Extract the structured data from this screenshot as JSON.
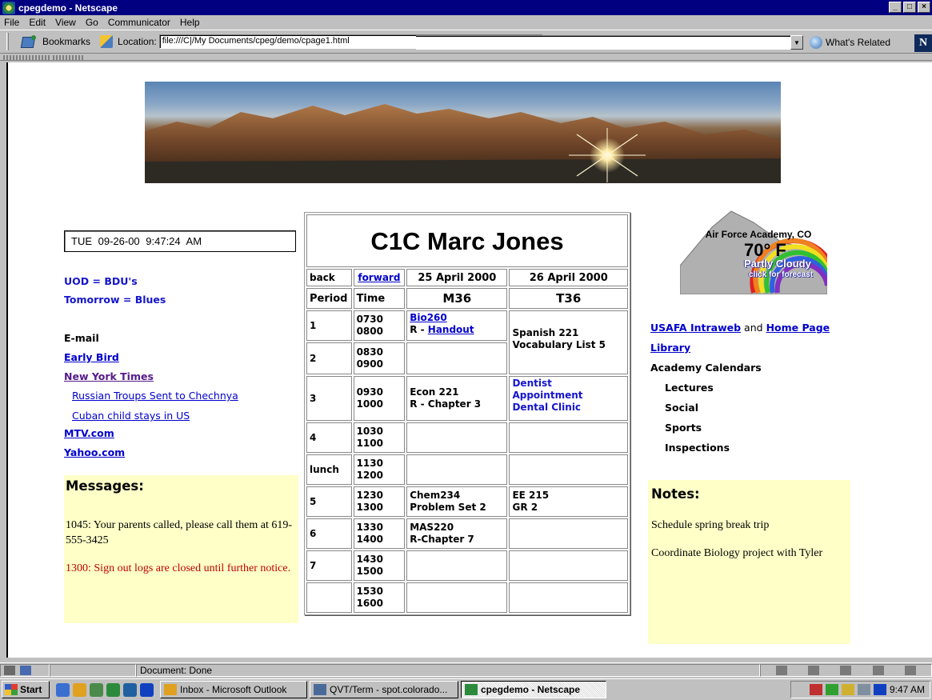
{
  "window": {
    "title": "cpegdemo - Netscape"
  },
  "menu": [
    "File",
    "Edit",
    "View",
    "Go",
    "Communicator",
    "Help"
  ],
  "toolbar": {
    "bookmarks_label": "Bookmarks",
    "location_label": "Location:",
    "url": "file:///C|/My Documents/cpeg/demo/cpage1.html",
    "whats_related_label": "What's Related"
  },
  "left": {
    "clock": "TUE   09-26-00   9:47:24 AM",
    "uod": "UOD = BDU's",
    "tomorrow": "Tomorrow = Blues",
    "email_label": "E-mail",
    "links": {
      "early_bird": "Early Bird",
      "nyt": "New York Times",
      "nyt_story1": "Russian Troups Sent to Chechnya",
      "nyt_story2": "Cuban child stays in US",
      "mtv": "MTV.com",
      "yahoo": "Yahoo.com "
    },
    "messages": {
      "title": "Messages:",
      "items": [
        "1045: Your parents called, please call them at 619-555-3425",
        "1300: Sign out logs are closed until further notice."
      ]
    }
  },
  "schedule": {
    "name": "C1C Marc Jones",
    "back": "back",
    "forward": "forward",
    "date1": "25 April 2000",
    "date2": "26 April 2000",
    "period_header": "Period",
    "time_header": "Time",
    "day1": "M36",
    "day2": "T36",
    "rows": [
      {
        "period": "1",
        "time1": "0730",
        "time2": "0800",
        "d1a": "Bio260",
        "d1b": "R - ",
        "d1link": "Handout",
        "d2": "Spanish 221 Vocabulary List 5"
      },
      {
        "period": "2",
        "time1": "0830",
        "time2": "0900"
      },
      {
        "period": "3",
        "time1": "0930",
        "time2": "1000",
        "d1a": "Econ 221",
        "d1b": "R - Chapter 3",
        "d2a": "Dentist",
        "d2b": "Appointment",
        "d2c": "Dental Clinic"
      },
      {
        "period": "4",
        "time1": "1030",
        "time2": "1100"
      },
      {
        "period": "lunch",
        "time1": "1130",
        "time2": "1200"
      },
      {
        "period": "5",
        "time1": "1230",
        "time2": "1300",
        "d1a": "Chem234",
        "d1b": "Problem Set 2",
        "d2a": "EE 215",
        "d2b": "GR 2"
      },
      {
        "period": "6",
        "time1": "1330",
        "time2": "1400",
        "d1a": "MAS220",
        "d1b": "R-Chapter 7"
      },
      {
        "period": "7",
        "time1": "1430",
        "time2": "1500"
      },
      {
        "period": "",
        "time1": "1530",
        "time2": "1600"
      }
    ]
  },
  "weather": {
    "location": "Air Force Academy, CO",
    "temp": "70° F",
    "condition": "Partly Cloudy",
    "cta": "click for forecast"
  },
  "right": {
    "intraweb": "USAFA Intraweb",
    "and_word": "and",
    "homepage": "Home Page",
    "library": "Library",
    "calendars": "Academy Calendars",
    "lectures": "Lectures",
    "social": "Social",
    "sports": "Sports",
    "inspections": "Inspections",
    "notes": {
      "title": "Notes:",
      "items": [
        "Schedule spring break trip",
        "Coordinate Biology project with Tyler"
      ]
    }
  },
  "statusbar": {
    "text": "Document: Done"
  },
  "taskbar": {
    "start": "Start",
    "tasks": [
      "Inbox - Microsoft Outlook",
      "QVT/Term - spot.colorado...",
      "cpegdemo - Netscape"
    ],
    "time": "9:47 AM"
  }
}
